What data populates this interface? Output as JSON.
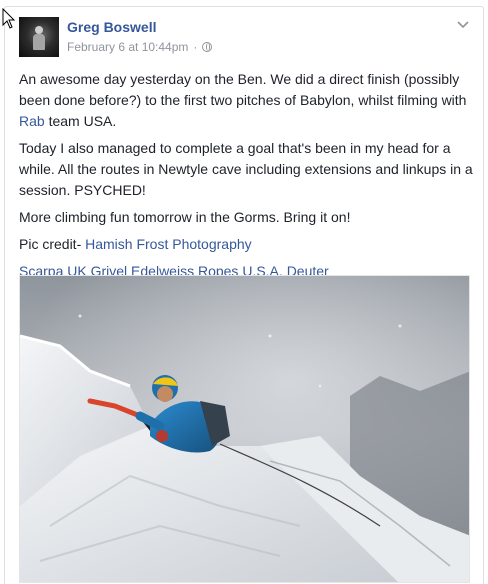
{
  "post": {
    "author": "Greg Boswell",
    "timestamp": "February 6 at 10:44pm",
    "separator": "·",
    "privacy_icon": "globe-icon",
    "options_icon": "chevron-down-icon",
    "paragraph1": {
      "text_before": "An awesome day yesterday on the Ben. We did a direct finish (possibly been done before?) to the first two pitches of Babylon, whilst filming with ",
      "link": "Rab",
      "text_after": " team USA."
    },
    "paragraph2": "Today I also managed to complete a goal that's been in my head for a while. All the routes in Newtyle cave including extensions and linkups in a session. PSYCHED!",
    "paragraph3": "More climbing fun tomorrow in the Gorms. Bring it on!",
    "pic_credit": {
      "label": "Pic credit- ",
      "link": "Hamish Frost Photography"
    },
    "sponsors": [
      "Scarpa UK",
      "Grivel",
      "Edelweiss Ropes",
      "U.S.A.",
      "Deuter"
    ]
  },
  "colors": {
    "link": "#365899",
    "meta": "#90949c",
    "text": "#1d2129",
    "border": "#dddfe2"
  }
}
